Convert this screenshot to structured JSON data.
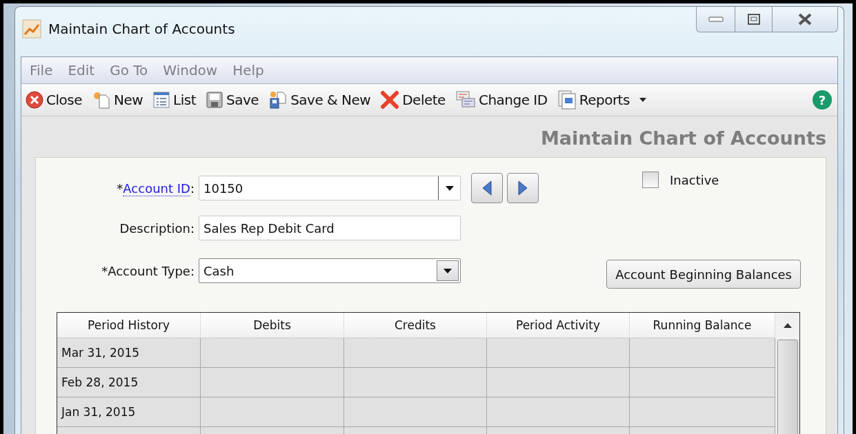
{
  "window": {
    "title": "Maintain Chart of Accounts"
  },
  "menu": [
    "File",
    "Edit",
    "Go To",
    "Window",
    "Help"
  ],
  "toolbar": [
    {
      "kind": "close",
      "label": "Close"
    },
    {
      "kind": "new",
      "label": "New"
    },
    {
      "kind": "list",
      "label": "List"
    },
    {
      "kind": "save",
      "label": "Save"
    },
    {
      "kind": "save_new",
      "label": "Save & New"
    },
    {
      "kind": "delete",
      "label": "Delete"
    },
    {
      "kind": "change_id",
      "label": "Change ID"
    },
    {
      "kind": "reports",
      "label": "Reports"
    }
  ],
  "help_button": "?",
  "heading": "Maintain Chart of Accounts",
  "form": {
    "account_id": {
      "label_prefix": "*",
      "label_link": "Account ID",
      "label_suffix": ":",
      "value": "10150"
    },
    "description": {
      "label": "Description:",
      "value": "Sales Rep Debit Card"
    },
    "account_type": {
      "label": "*Account Type:",
      "value": "Cash"
    },
    "inactive": {
      "label": "Inactive",
      "checked": false
    },
    "beginning_balances_button": "Account Beginning Balances"
  },
  "table": {
    "columns": [
      "Period History",
      "Debits",
      "Credits",
      "Period Activity",
      "Running Balance"
    ],
    "rows": [
      [
        "Mar 31, 2015",
        "",
        "",
        "",
        ""
      ],
      [
        "Feb 28, 2015",
        "",
        "",
        "",
        ""
      ],
      [
        "Jan 31, 2015",
        "",
        "",
        "",
        ""
      ],
      [
        "",
        "",
        "",
        "",
        ""
      ]
    ]
  }
}
